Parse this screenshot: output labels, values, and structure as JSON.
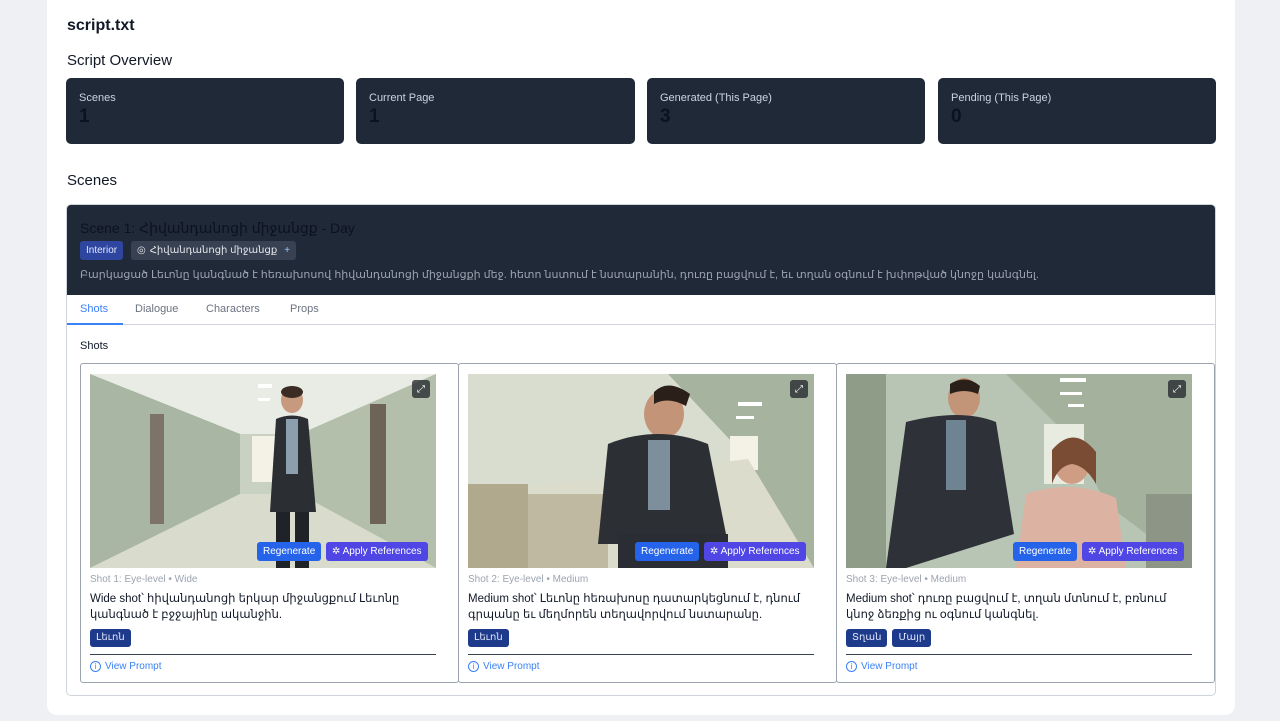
{
  "file": {
    "name": "script.txt"
  },
  "overview": {
    "title": "Script Overview",
    "stats": [
      {
        "label": "Scenes",
        "value": "1"
      },
      {
        "label": "Current Page",
        "value": "1"
      },
      {
        "label": "Generated (This Page)",
        "value": "3"
      },
      {
        "label": "Pending (This Page)",
        "value": "0"
      }
    ]
  },
  "scenes": {
    "title": "Scenes",
    "scene": {
      "title": "Scene 1: Հիվանդանոցի միջանցք - Day",
      "type_badge": "Interior",
      "location": "Հիվանդանոցի միջանցք",
      "location_add": "+",
      "description": "Բարկացած Լեւոնը կանգնած է հեռախոսով հիվանդանոցի միջանցքի մեջ. հետո նստում է նստարանին, դուռը բացվում է, եւ տղան օգնում է խփոթված կնոջը կանգնել.",
      "tabs": [
        "Shots",
        "Dialogue",
        "Characters",
        "Props"
      ],
      "active_tab": "Shots",
      "shots_label": "Shots",
      "shots": [
        {
          "meta": "Shot 1: Eye-level • Wide",
          "description": "Wide shot՝ հիվանդանոցի երկար միջանցքում Լեւոնը կանգնած է բջջայինը ականջին.",
          "characters": [
            "Լեւոն"
          ],
          "regenerate": "Regenerate",
          "apply": "Apply References",
          "view_prompt": "View Prompt"
        },
        {
          "meta": "Shot 2: Eye-level • Medium",
          "description": "Medium shot՝ Լեւոնը հեռախոսը դատարկեցնում է, դնում գրպանը եւ մեղմորեն տեղավորվում նստարանը.",
          "characters": [
            "Լեւոն"
          ],
          "regenerate": "Regenerate",
          "apply": "Apply References",
          "view_prompt": "View Prompt"
        },
        {
          "meta": "Shot 3: Eye-level • Medium",
          "description": "Medium shot՝ դուռը բացվում է, տղան մտնում է, բռնում կնոջ ձեռքից ու օգնում կանգնել.",
          "characters": [
            "Տղան",
            "Մայր"
          ],
          "regenerate": "Regenerate",
          "apply": "Apply References",
          "view_prompt": "View Prompt"
        }
      ]
    }
  },
  "colors": {
    "dark_card": "#1f2937",
    "accent_blue": "#3b82f6",
    "regen": "#2563eb",
    "apply": "#4f46e5"
  }
}
